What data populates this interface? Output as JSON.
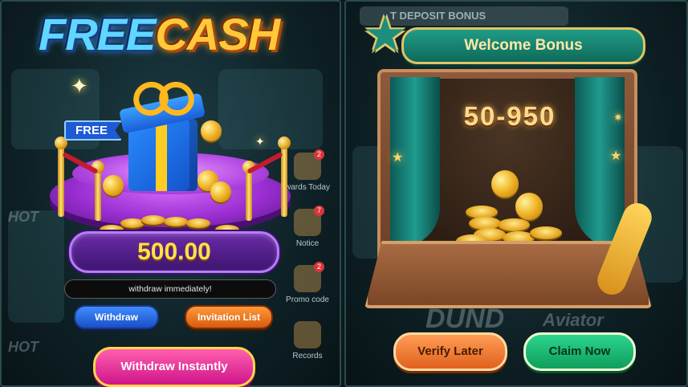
{
  "left_panel": {
    "title_free": "FREE",
    "title_cash": "CASH",
    "free_tag": "FREE",
    "amount": "500.00",
    "info_text": "withdraw immediately!",
    "withdraw_label": "Withdraw",
    "invitation_label": "Invitation List",
    "withdraw_instantly_label": "Withdraw Instantly",
    "side_menu": [
      {
        "label": "wards Today",
        "badge": "2"
      },
      {
        "label": "Notice",
        "badge": "7"
      },
      {
        "label": "Promo code",
        "badge": "2"
      },
      {
        "label": "Records",
        "badge": ""
      }
    ],
    "bg_labels": [
      "HOT",
      "HOT"
    ]
  },
  "right_panel": {
    "top_banner": "T DEPOSIT BONUS",
    "header": "Welcome Bonus",
    "bonus_range": "50-950",
    "bg_text_1": "DUND",
    "bg_text_2": "Aviator",
    "verify_later_label": "Verify Later",
    "claim_now_label": "Claim Now"
  },
  "colors": {
    "free_blue": "#5fd7ff",
    "cash_gold": "#ffc93a",
    "amount_purple": "#5a2390",
    "amount_text": "#ffe04a",
    "header_teal": "#1f9c86",
    "claim_green": "#1fbf77",
    "verify_orange": "#ef7b36",
    "instant_pink": "#e63598"
  }
}
